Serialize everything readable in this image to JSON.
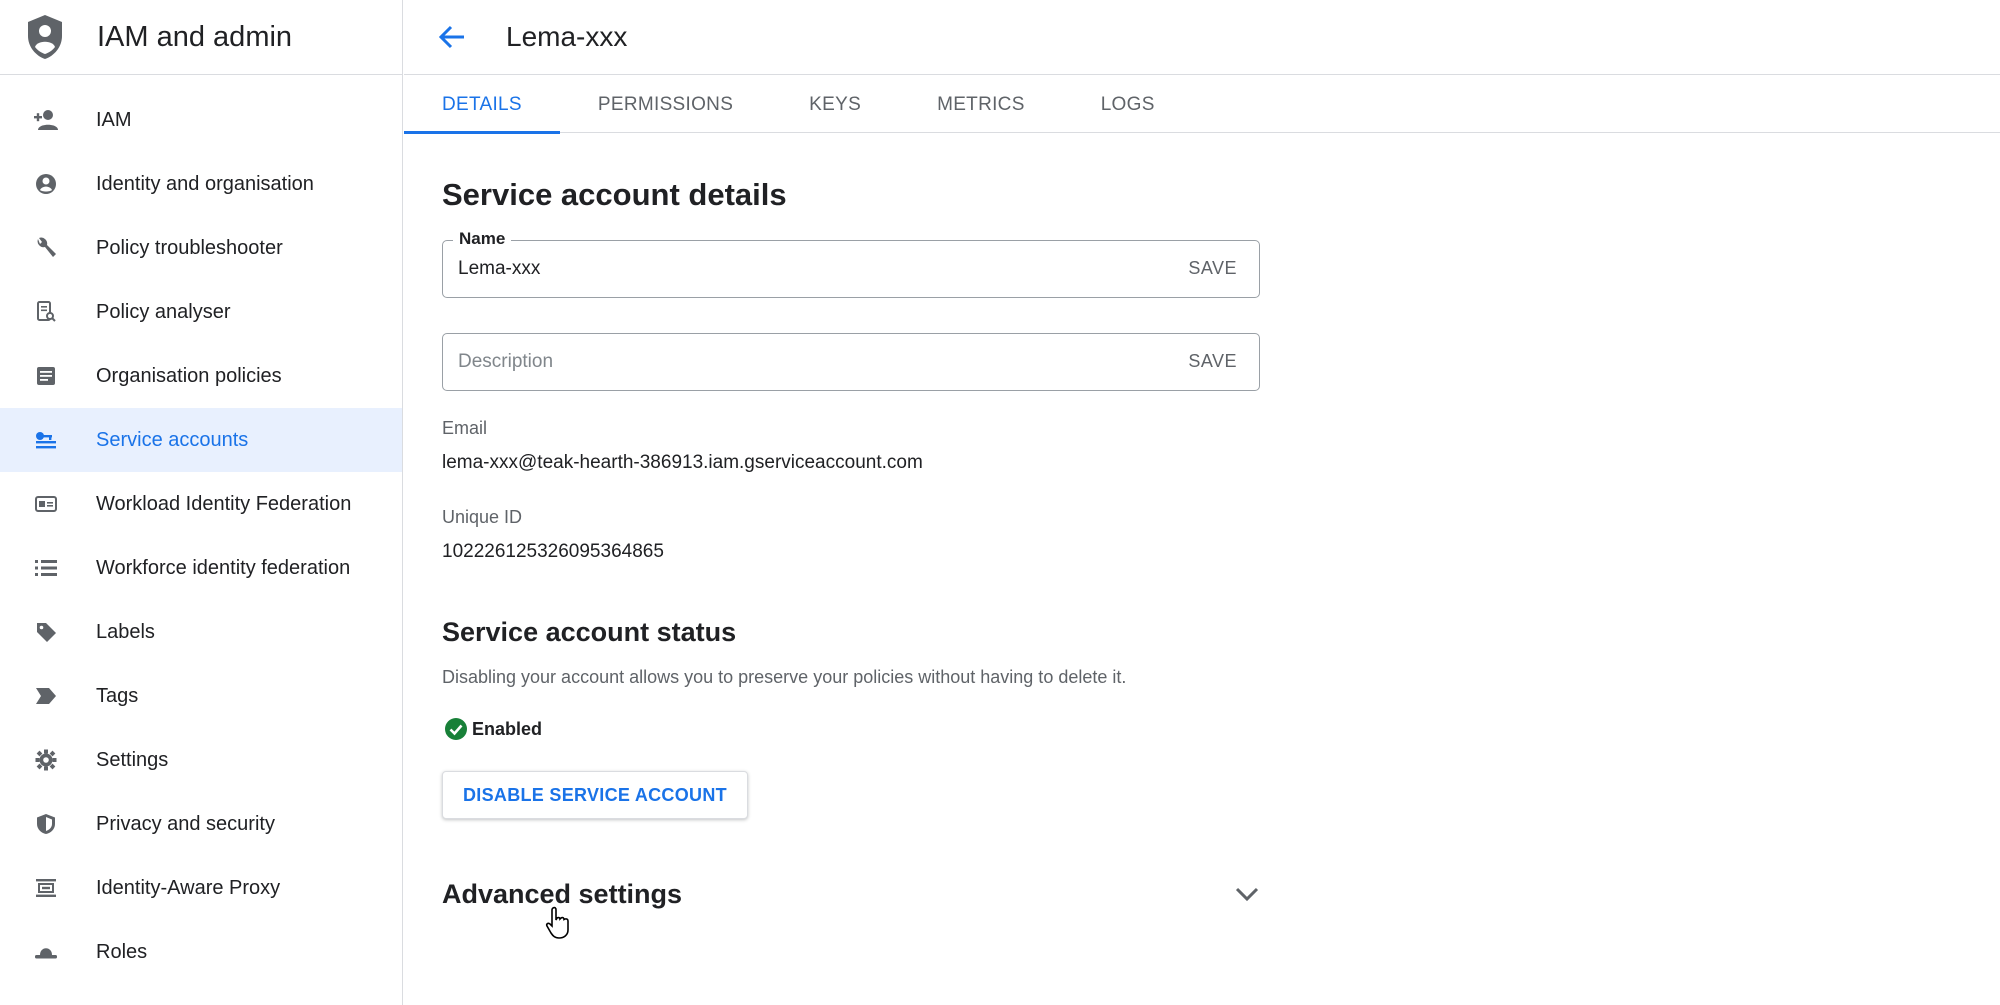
{
  "app": {
    "title": "IAM and admin"
  },
  "sidebar": {
    "items": [
      {
        "label": "IAM",
        "icon": "person-add-icon"
      },
      {
        "label": "Identity and organisation",
        "icon": "account-circle-icon"
      },
      {
        "label": "Policy troubleshooter",
        "icon": "wrench-icon"
      },
      {
        "label": "Policy analyser",
        "icon": "document-search-icon"
      },
      {
        "label": "Organisation policies",
        "icon": "article-icon"
      },
      {
        "label": "Service accounts",
        "icon": "service-account-icon",
        "active": true
      },
      {
        "label": "Workload Identity Federation",
        "icon": "id-card-icon"
      },
      {
        "label": "Workforce identity federation",
        "icon": "list-icon"
      },
      {
        "label": "Labels",
        "icon": "label-tag-icon"
      },
      {
        "label": "Tags",
        "icon": "tag-arrow-icon"
      },
      {
        "label": "Settings",
        "icon": "gear-icon"
      },
      {
        "label": "Privacy and security",
        "icon": "shield-icon"
      },
      {
        "label": "Identity-Aware Proxy",
        "icon": "proxy-icon"
      },
      {
        "label": "Roles",
        "icon": "hat-icon"
      }
    ]
  },
  "header": {
    "title": "Lema-xxx",
    "back_icon": "arrow-back-icon"
  },
  "tabs": [
    {
      "label": "DETAILS",
      "active": true
    },
    {
      "label": "PERMISSIONS"
    },
    {
      "label": "KEYS"
    },
    {
      "label": "METRICS"
    },
    {
      "label": "LOGS"
    }
  ],
  "details": {
    "heading": "Service account details",
    "name_field": {
      "label": "Name",
      "value": "Lema-xxx",
      "save": "SAVE"
    },
    "description_field": {
      "placeholder": "Description",
      "save": "SAVE"
    },
    "email": {
      "label": "Email",
      "value": "lema-xxx@teak-hearth-386913.iam.gserviceaccount.com"
    },
    "unique_id": {
      "label": "Unique ID",
      "value": "102226125326095364865"
    }
  },
  "status_section": {
    "heading": "Service account status",
    "description": "Disabling your account allows you to preserve your policies without having to delete it.",
    "status": "Enabled",
    "disable_button": "DISABLE SERVICE ACCOUNT"
  },
  "advanced": {
    "heading": "Advanced settings"
  },
  "colors": {
    "accent": "#1a73e8",
    "active_bg": "#e8f0fe",
    "enabled_green": "#188038",
    "text": "#202124",
    "muted": "#5f6368"
  }
}
